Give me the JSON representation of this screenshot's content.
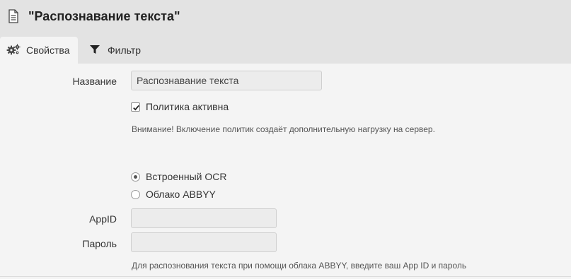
{
  "header": {
    "title": "\"Распознавание текста\"",
    "icon": "document-icon"
  },
  "tabs": [
    {
      "label": "Свойства",
      "icon": "gears-icon",
      "active": true
    },
    {
      "label": "Фильтр",
      "icon": "filter-icon",
      "active": false
    }
  ],
  "form": {
    "name_label": "Название",
    "name_value": "Распознавание текста",
    "policy_active_label": "Политика активна",
    "policy_active_checked": true,
    "warning": "Внимание! Включение политик создаёт дополнительную нагрузку на сервер.",
    "ocr_options": [
      {
        "label": "Встроенный OCR",
        "selected": true
      },
      {
        "label": "Облако ABBYY",
        "selected": false
      }
    ],
    "appid_label": "AppID",
    "appid_value": "",
    "password_label": "Пароль",
    "password_value": "",
    "abbyy_hint": "Для распознования текста при помощи облака ABBYY, введите ваш App ID и пароль"
  },
  "colors": {
    "header_bg": "#e3e3e3",
    "page_bg": "#f4f4f4",
    "input_bg": "#ececec",
    "input_border": "#cfcfcf"
  }
}
